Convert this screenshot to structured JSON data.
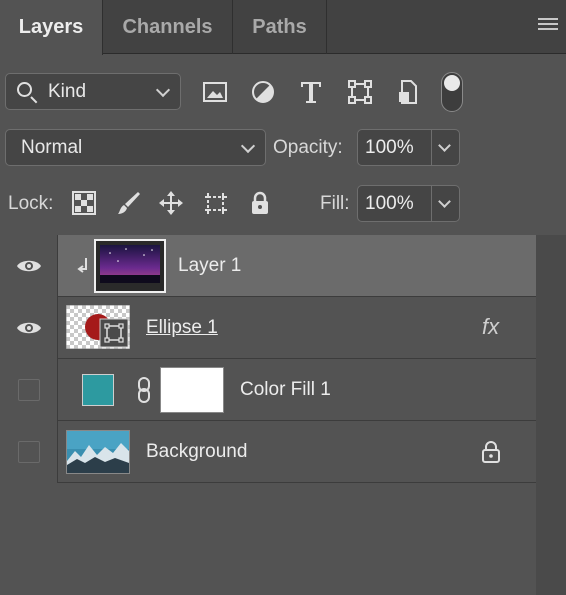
{
  "tabs": [
    {
      "label": "Layers",
      "active": true
    },
    {
      "label": "Channels",
      "active": false
    },
    {
      "label": "Paths",
      "active": false
    }
  ],
  "filter": {
    "kind_value": "Kind",
    "icons": [
      "image-filter-icon",
      "adjustment-filter-icon",
      "type-filter-icon",
      "shape-filter-icon",
      "smart-object-filter-icon",
      "filter-toggle-switch"
    ]
  },
  "blend": {
    "mode": "Normal",
    "opacity_label": "Opacity:",
    "opacity_value": "100%"
  },
  "lock": {
    "label": "Lock:",
    "icons": [
      "lock-transparent-pixels-icon",
      "lock-image-pixels-icon",
      "lock-position-icon",
      "lock-artboard-icon",
      "lock-all-icon"
    ],
    "fill_label": "Fill:",
    "fill_value": "100%"
  },
  "layers": [
    {
      "name": "Layer 1",
      "visible": true,
      "selected": true,
      "clipped": true
    },
    {
      "name": "Ellipse 1",
      "visible": true,
      "selected": false,
      "fx": "fx"
    },
    {
      "name": "Color Fill 1",
      "visible": false,
      "selected": false,
      "fill_color": "#2d9aa0"
    },
    {
      "name": "Background",
      "visible": false,
      "selected": false,
      "locked": true
    }
  ],
  "colors": {
    "panel_bg": "#535353",
    "selected_row": "#6b6b6b",
    "ellipse_red": "#a51a1a",
    "color_fill": "#2d9aa0"
  }
}
